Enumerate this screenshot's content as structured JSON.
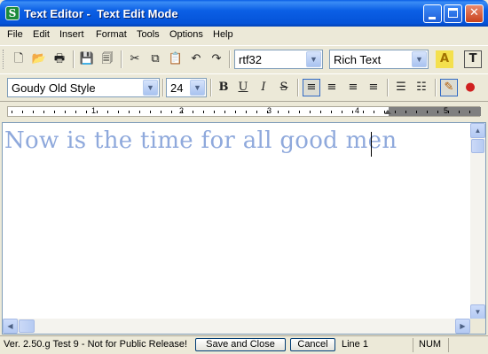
{
  "window": {
    "title": "Text Editor -  Text Edit Mode",
    "app_icon": "S",
    "controls": {
      "minimize": "",
      "maximize": "",
      "close": "✕"
    }
  },
  "menu": [
    "File",
    "Edit",
    "Insert",
    "Format",
    "Tools",
    "Options",
    "Help"
  ],
  "toolbar1": {
    "buttons": [
      {
        "name": "new-icon",
        "glyph": "🗋"
      },
      {
        "name": "open-folder-icon",
        "glyph": "📂"
      },
      {
        "name": "print-icon",
        "glyph": "🖶"
      },
      {
        "name": "save-icon",
        "glyph": "💾"
      },
      {
        "name": "save-all-icon",
        "glyph": "🗐"
      },
      {
        "name": "cut-icon",
        "glyph": "✂"
      },
      {
        "name": "copy-icon",
        "glyph": "⧉"
      },
      {
        "name": "paste-icon",
        "glyph": "📋"
      },
      {
        "name": "undo-icon",
        "glyph": "↶"
      },
      {
        "name": "redo-icon",
        "glyph": "↷"
      }
    ],
    "format_combo": "rtf32",
    "mode_combo": "Rich Text",
    "highlight_glyph": "A",
    "text_frame_glyph": "T"
  },
  "toolbar2": {
    "font_combo": "Goudy Old Style",
    "size_combo": "24",
    "bold": "B",
    "underline": "U",
    "italic": "I",
    "strike": "S",
    "align_left": "≡",
    "align_center": "≡",
    "align_right": "≡",
    "justify": "≡",
    "bullets": "☰",
    "numbering": "☷",
    "pen_glyph": "✎",
    "colors_glyph": "●"
  },
  "ruler": {
    "labels": [
      "1",
      "2",
      "3",
      "4",
      "5"
    ]
  },
  "document": {
    "text": "Now is the time for all good men"
  },
  "status": {
    "version": "Ver. 2.50.g  Test 9 - Not for Public Release!",
    "save_close_label": "Save and Close",
    "cancel_label": "Cancel",
    "line": "Line 1",
    "num": "NUM"
  }
}
